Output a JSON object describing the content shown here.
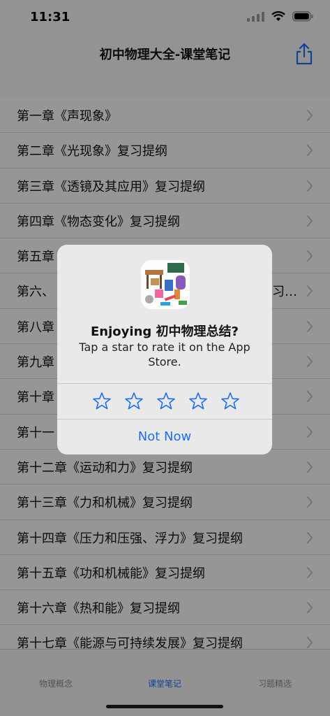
{
  "status_bar": {
    "time": "11:31"
  },
  "nav": {
    "title": "初中物理大全-课堂笔记",
    "share_icon": "share-icon"
  },
  "list": {
    "items": [
      {
        "label": "第一章《声现象》"
      },
      {
        "label": "第二章《光现象》复习提纲"
      },
      {
        "label": "第三章《透镜及其应用》复习提纲"
      },
      {
        "label": "第四章《物态变化》复习提纲"
      },
      {
        "label": "第五章"
      },
      {
        "label": "第六、"
      },
      {
        "label": "第八章"
      },
      {
        "label": "第九章"
      },
      {
        "label": "第十章"
      },
      {
        "label": "第十一"
      },
      {
        "label": "第十二章《运动和力》复习提纲"
      },
      {
        "label": "第十三章《力和机械》复习提纲"
      },
      {
        "label": "第十四章《压力和压强、浮力》复习提纲"
      },
      {
        "label": "第十五章《功和机械能》复习提纲"
      },
      {
        "label": "第十六章《热和能》复习提纲"
      },
      {
        "label": "第十七章《能源与可持续发展》复习提纲"
      }
    ],
    "row6_tail": "习…"
  },
  "tabs": {
    "items": [
      {
        "label": "物理概念"
      },
      {
        "label": "课堂笔记"
      },
      {
        "label": "习题精选"
      }
    ],
    "active_index": 1
  },
  "alert": {
    "title": "Enjoying 初中物理总结?",
    "message": "Tap a star to rate it on the App Store.",
    "star_count": 5,
    "rating": 0,
    "not_now": "Not Now"
  },
  "colors": {
    "accent": "#1d6ef5"
  }
}
